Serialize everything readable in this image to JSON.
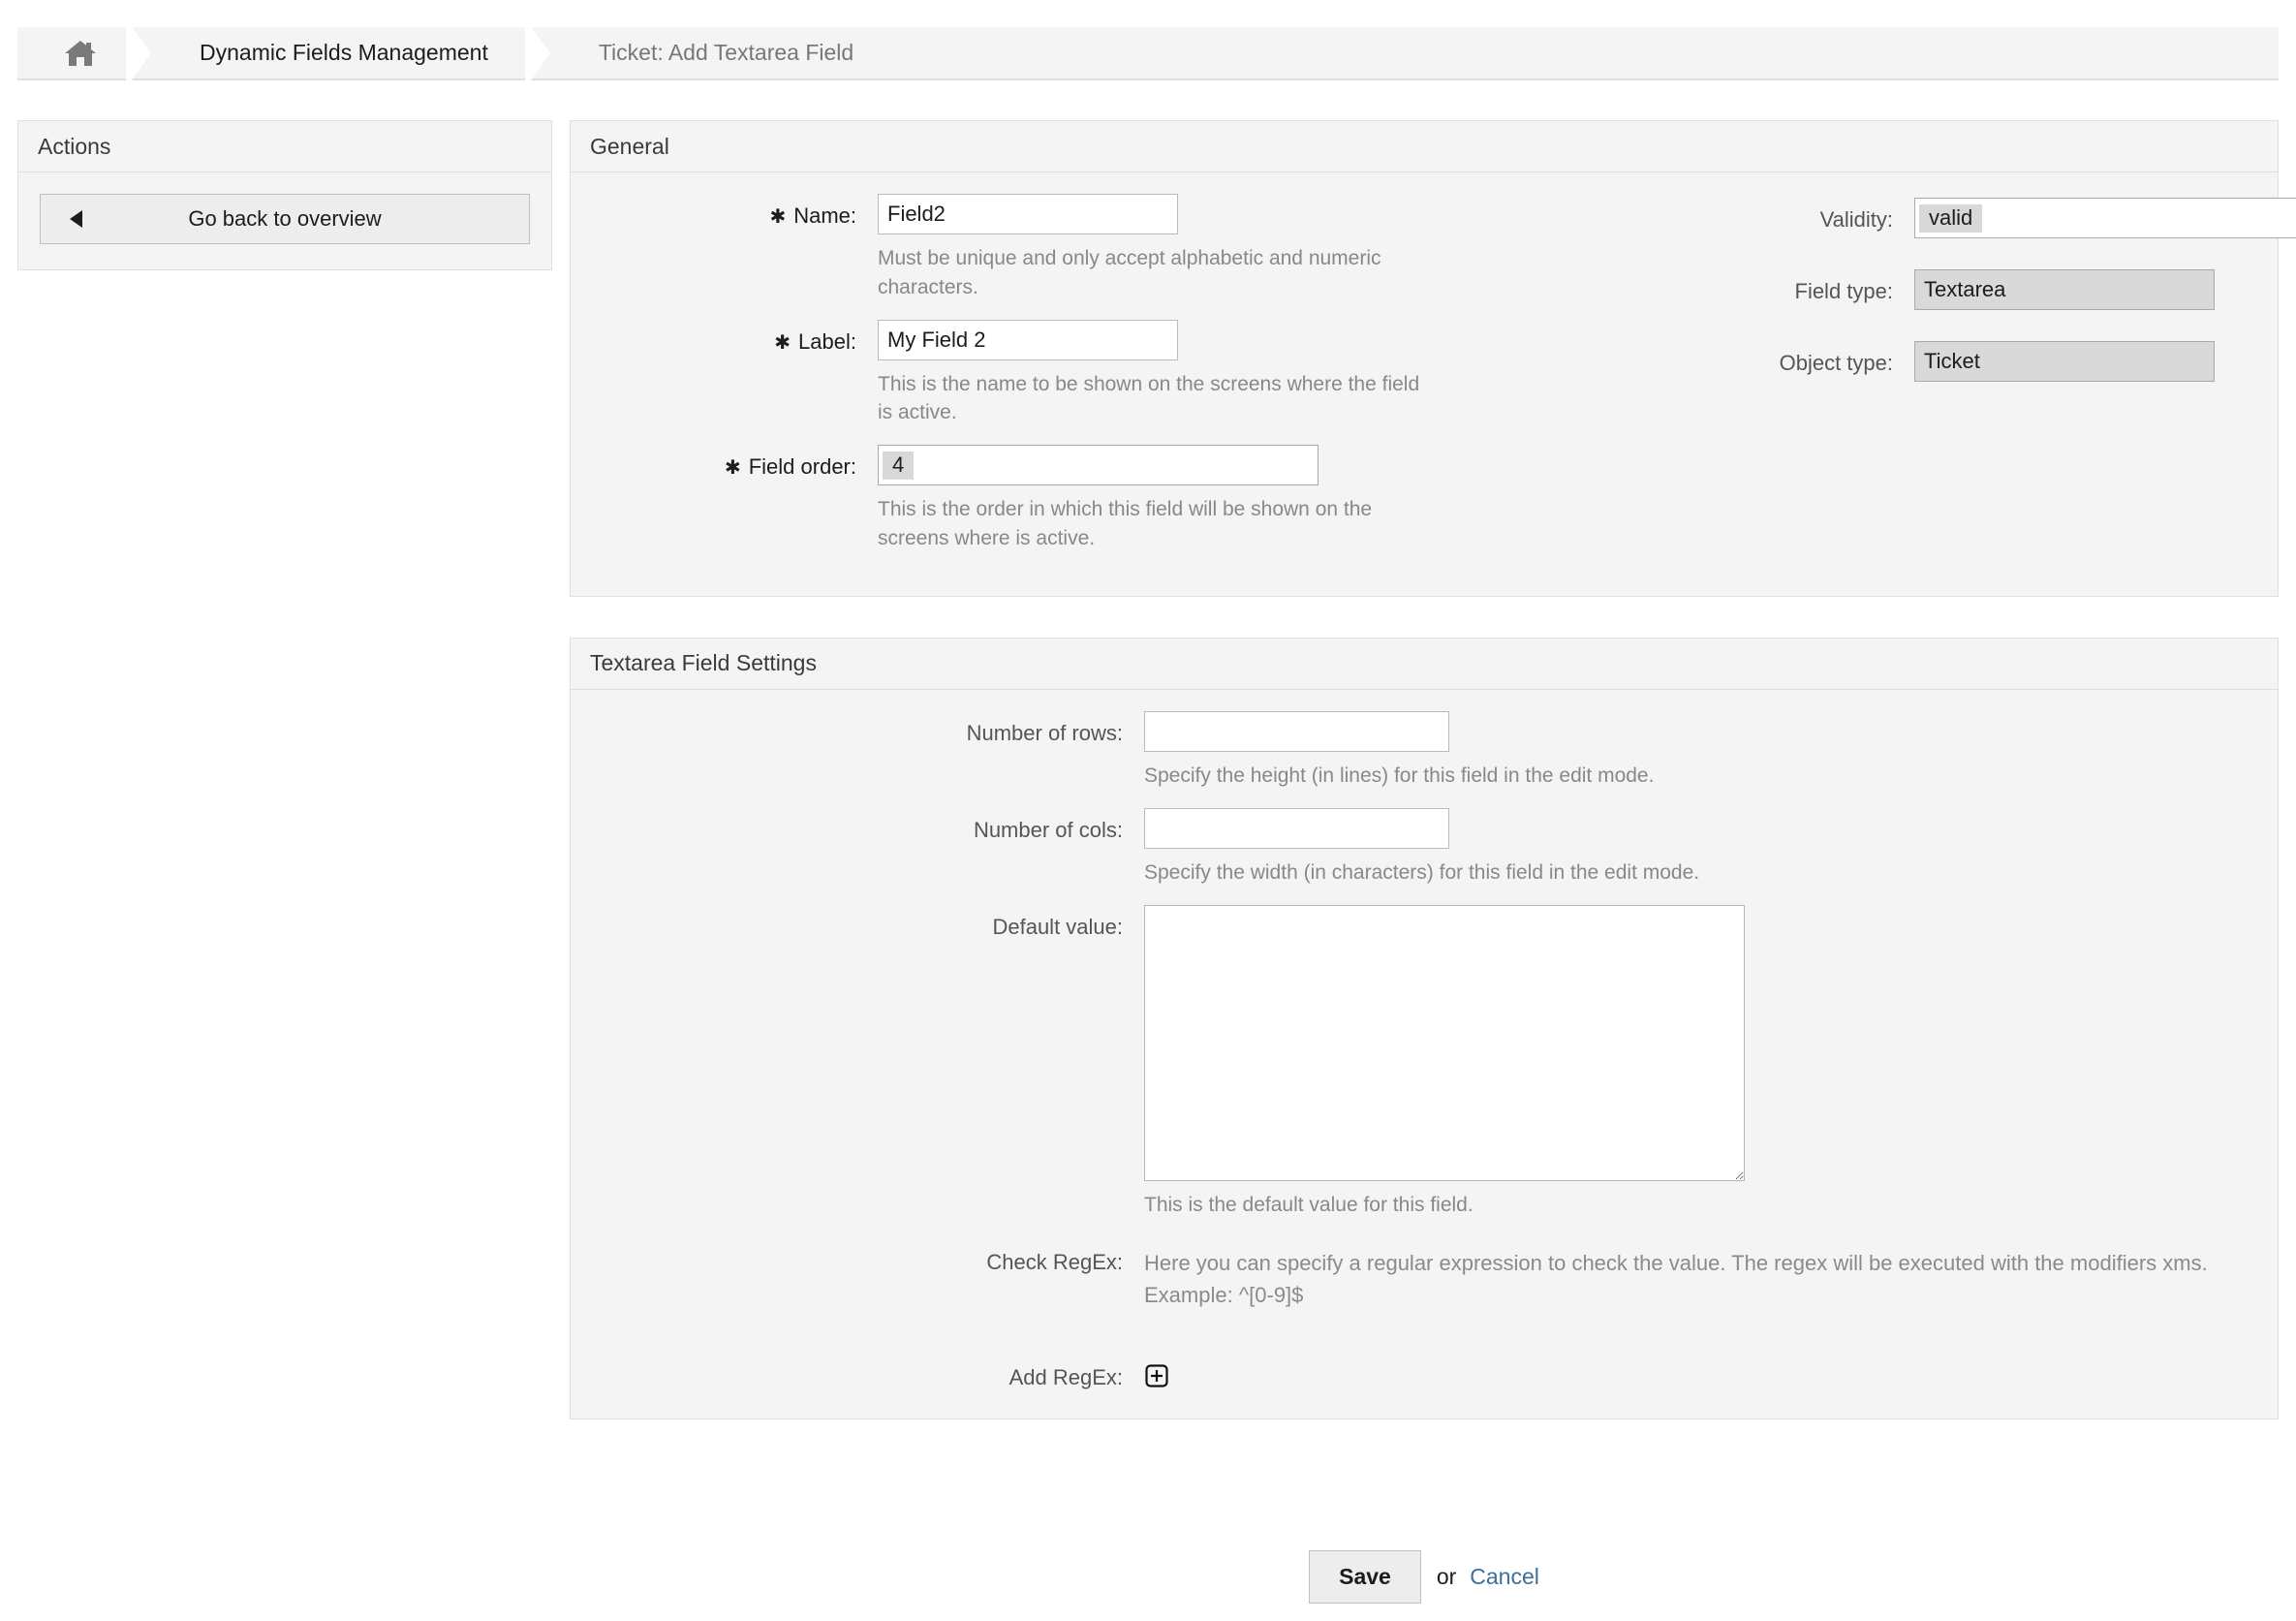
{
  "breadcrumb": {
    "home_icon": "home-icon",
    "items": [
      {
        "label": "Dynamic Fields Management",
        "current": false
      },
      {
        "label": "Ticket: Add Textarea Field",
        "current": true
      }
    ]
  },
  "sidebar": {
    "title": "Actions",
    "back_button": {
      "label": "Go back to overview",
      "icon": "triangle-left-icon"
    }
  },
  "general": {
    "title": "General",
    "name": {
      "label": "Name:",
      "required_marker": "✱",
      "value": "Field2",
      "hint": "Must be unique and only accept alphabetic and numeric characters."
    },
    "label": {
      "label": "Label:",
      "required_marker": "✱",
      "value": "My Field 2",
      "hint": "This is the name to be shown on the screens where the field is active."
    },
    "field_order": {
      "label": "Field order:",
      "required_marker": "✱",
      "value": "4",
      "hint": "This is the order in which this field will be shown on the screens where is active."
    },
    "validity": {
      "label": "Validity:",
      "value": "valid"
    },
    "field_type": {
      "label": "Field type:",
      "value": "Textarea"
    },
    "object_type": {
      "label": "Object type:",
      "value": "Ticket"
    }
  },
  "textarea_settings": {
    "title": "Textarea Field Settings",
    "rows": {
      "label": "Number of rows:",
      "value": "",
      "hint": "Specify the height (in lines) for this field in the edit mode."
    },
    "cols": {
      "label": "Number of cols:",
      "value": "",
      "hint": "Specify the width (in characters) for this field in the edit mode."
    },
    "default_value": {
      "label": "Default value:",
      "value": "",
      "hint": "This is the default value for this field."
    },
    "check_regex": {
      "label": "Check RegEx:",
      "line1": "Here you can specify a regular expression to check the value. The regex will be executed with the modifiers xms.",
      "line2": "Example: ^[0-9]$"
    },
    "add_regex": {
      "label": "Add RegEx:",
      "icon": "plus-box-icon"
    }
  },
  "footer": {
    "save_label": "Save",
    "or_label": "or",
    "cancel_label": "Cancel"
  },
  "colors": {
    "panel_bg": "#f4f4f4",
    "panel_border": "#e0e0e0",
    "hint_text": "#888888",
    "link": "#3c6e9b",
    "readonly_bg": "#d9d9d9",
    "selection_bg": "#d8d8d8"
  }
}
